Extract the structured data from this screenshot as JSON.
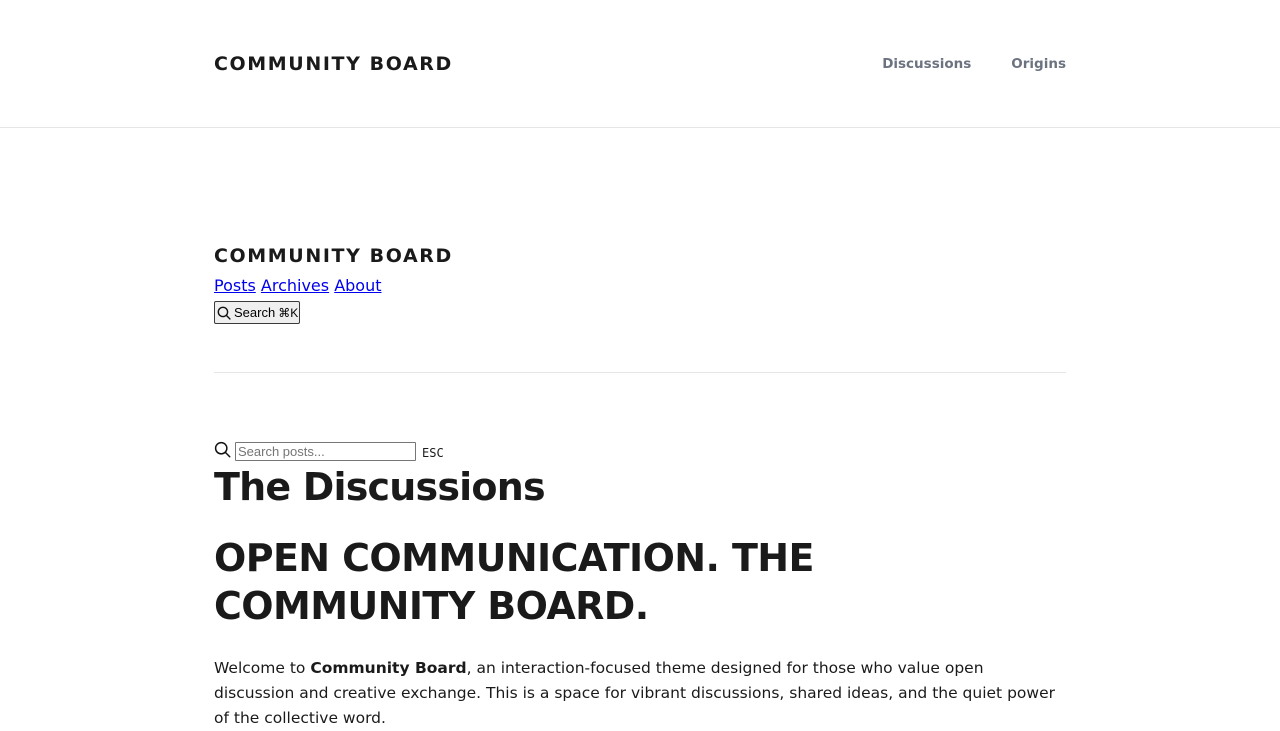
{
  "header": {
    "brand": "COMMUNITY BOARD",
    "nav": [
      {
        "label": "Discussions"
      },
      {
        "label": "Origins"
      }
    ]
  },
  "site_header": {
    "brand": "COMMUNITY BOARD",
    "links": [
      {
        "label": "Posts"
      },
      {
        "label": "Archives"
      },
      {
        "label": "About"
      }
    ],
    "search_button": {
      "label": "Search",
      "shortcut": "⌘K",
      "icon": "search-icon"
    }
  },
  "search": {
    "placeholder": "Search posts...",
    "value": "",
    "close_hint": "ESC",
    "icon": "search-icon"
  },
  "main": {
    "title": "The Discussions",
    "hero": "OPEN COMMUNICATION. THE COMMUNITY BOARD.",
    "intro": {
      "before": "Welcome to ",
      "bold": "Community Board",
      "after": ", an interaction-focused theme designed for those who value open discussion and creative exchange. This is a space for vibrant discussions, shared ideas, and the quiet power of the collective word."
    }
  },
  "colors": {
    "text": "#1a1a1a",
    "nav_muted": "#6b7280",
    "link": "#0000ee",
    "divider": "#e6e6e6"
  }
}
